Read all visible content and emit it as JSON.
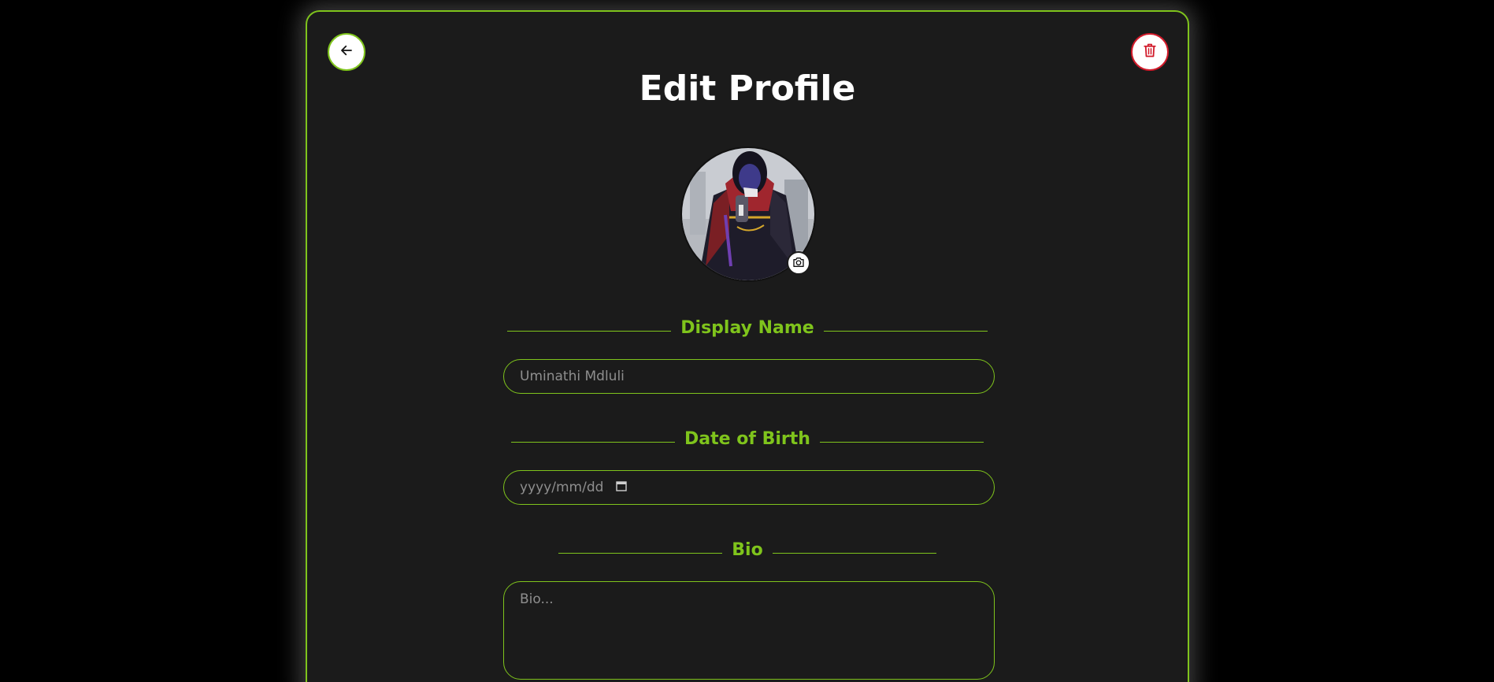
{
  "page": {
    "title": "Edit Profile"
  },
  "header": {
    "back_icon": "arrow-left-icon",
    "delete_icon": "trash-icon"
  },
  "profile": {
    "avatar_alt": "profile avatar",
    "camera_icon": "camera-icon"
  },
  "sections": {
    "display_name": {
      "label": "Display Name",
      "placeholder": "Uminathi Mdluli"
    },
    "dob": {
      "label": "Date of Birth",
      "placeholder": "yyyy/mm/dd"
    },
    "bio": {
      "label": "Bio",
      "placeholder": "Bio..."
    }
  },
  "colors": {
    "accent": "#7fc41c",
    "danger": "#d11a2a",
    "card_bg": "#1b1b1b",
    "page_bg": "#000000"
  }
}
